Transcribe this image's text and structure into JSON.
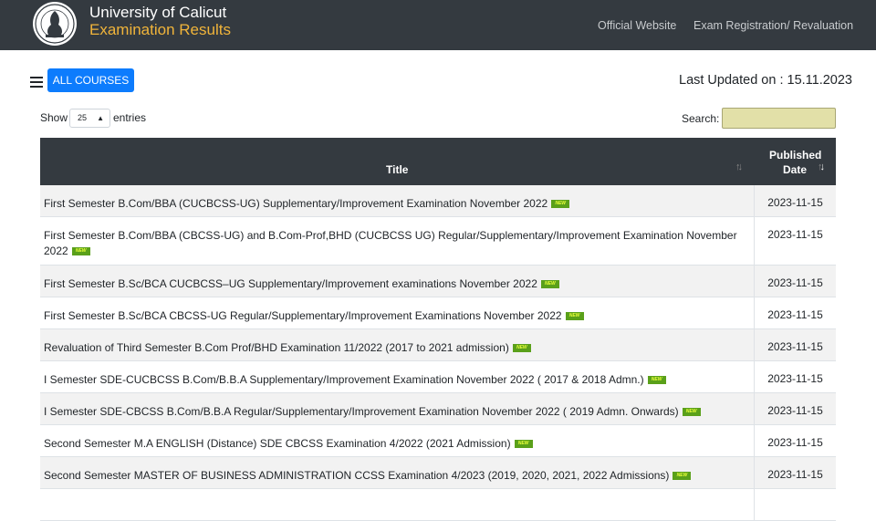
{
  "header": {
    "brand_line1": "University of Calicut",
    "brand_line2": "Examination Results",
    "nav": [
      "Official Website",
      "Exam Registration/ Revaluation"
    ],
    "colors": {
      "bar": "#343a40",
      "accent": "#f0b43a"
    }
  },
  "toolbar": {
    "all_courses_label": "ALL COURSES",
    "last_updated": "Last Updated on : 15.11.2023",
    "show_label": "Show",
    "entries_value": "25",
    "entries_label": "entries",
    "search_label": "Search:",
    "search_value": ""
  },
  "table": {
    "columns": [
      "Title",
      "Published Date"
    ],
    "badge_text": "NEW",
    "rows": [
      {
        "title": "First Semester B.Com/BBA (CUCBCSS-UG) Supplementary/Improvement Examination November 2022",
        "date": "2023-11-15"
      },
      {
        "title": "First Semester B.Com/BBA (CBCSS-UG) and B.Com-Prof,BHD (CUCBCSS UG) Regular/Supplementary/Improvement Examination November 2022",
        "date": "2023-11-15"
      },
      {
        "title": "First Semester B.Sc/BCA CUCBCSS–UG Supplementary/Improvement examinations November 2022",
        "date": "2023-11-15"
      },
      {
        "title": "First Semester B.Sc/BCA CBCSS-UG Regular/Supplementary/Improvement Examinations November 2022",
        "date": "2023-11-15"
      },
      {
        "title": "Revaluation of Third Semester B.Com Prof/BHD Examination 11/2022 (2017 to 2021 admission)",
        "date": "2023-11-15"
      },
      {
        "title": "I Semester SDE-CUCBCSS B.Com/B.B.A Supplementary/Improvement Examination November 2022 ( 2017 & 2018 Admn.)",
        "date": "2023-11-15"
      },
      {
        "title": "I Semester SDE-CBCSS B.Com/B.B.A Regular/Supplementary/Improvement Examination November 2022 ( 2019 Admn. Onwards)",
        "date": "2023-11-15"
      },
      {
        "title": "Second Semester M.A ENGLISH (Distance) SDE CBCSS Examination 4/2022 (2021 Admission)",
        "date": "2023-11-15"
      },
      {
        "title": "Second Semester MASTER OF BUSINESS ADMINISTRATION CCSS Examination 4/2023 (2019, 2020, 2021, 2022 Admissions)",
        "date": "2023-11-15"
      },
      {
        "title": "",
        "date": ""
      }
    ]
  }
}
